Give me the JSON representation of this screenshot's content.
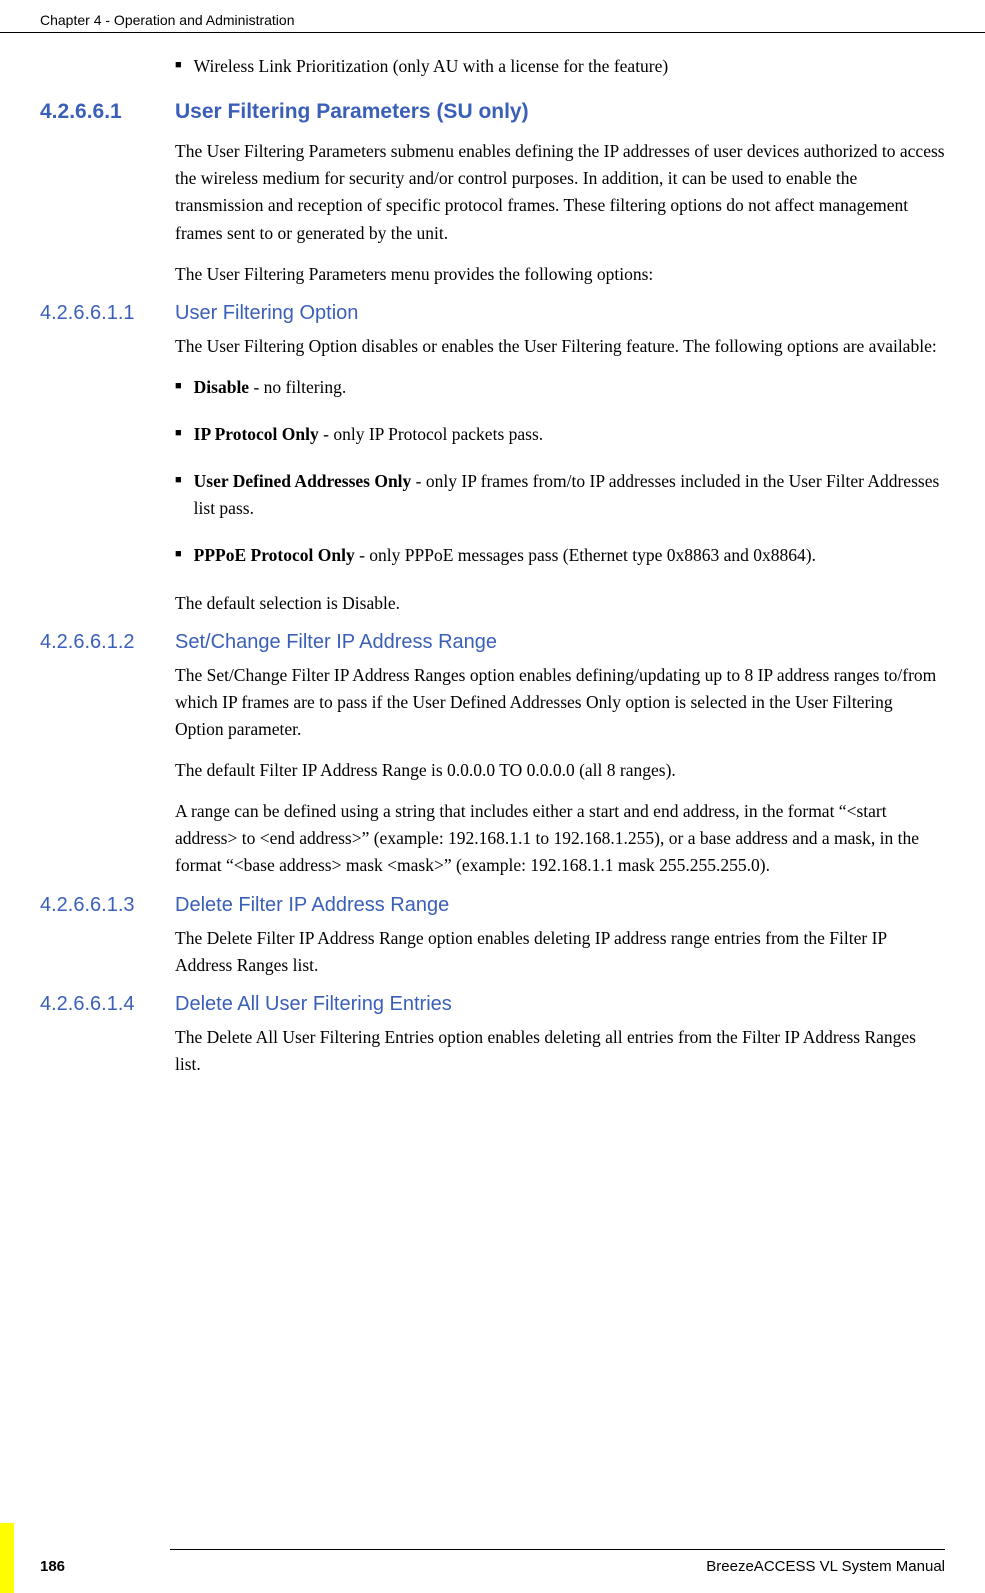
{
  "header": {
    "chapter": "Chapter 4 - Operation and Administration"
  },
  "bullets": {
    "intro": "Wireless Link Prioritization (only AU with a license for the feature)"
  },
  "s1": {
    "num": "4.2.6.6.1",
    "title": "User Filtering Parameters (SU only)",
    "p1": "The User Filtering Parameters submenu enables defining the IP addresses of user devices authorized to access the wireless medium for security and/or control purposes. In addition, it can be used to enable the transmission and reception of specific protocol frames. These filtering options do not affect management frames sent to or generated by the unit.",
    "p2": "The User Filtering Parameters menu provides the following options:"
  },
  "s11": {
    "num": "4.2.6.6.1.1",
    "title": "User Filtering Option",
    "p1": "The User Filtering Option disables or enables the User Filtering feature. The following options are available:",
    "b1_bold": "Disable",
    "b1_rest": " - no filtering.",
    "b2_bold": "IP Protocol Only",
    "b2_rest": " - only IP Protocol packets pass.",
    "b3_bold": "User Defined Addresses Only",
    "b3_rest": " - only IP frames from/to IP addresses included in the User Filter Addresses list pass.",
    "b4_bold": "PPPoE Protocol Only",
    "b4_rest": " - only PPPoE messages pass (Ethernet type 0x8863 and 0x8864).",
    "p2": "The default selection is Disable."
  },
  "s12": {
    "num": "4.2.6.6.1.2",
    "title": "Set/Change Filter IP Address Range",
    "p1": "The Set/Change Filter IP Address Ranges option enables defining/updating up to 8 IP address ranges to/from which IP frames are to pass if the User Defined Addresses Only option is selected in the User Filtering Option parameter.",
    "p2": "The default Filter IP Address Range is 0.0.0.0 TO 0.0.0.0 (all 8 ranges).",
    "p3": "A range can be defined using a string that includes either a start and end address, in the format “<start address> to <end address>” (example: 192.168.1.1 to 192.168.1.255), or a base address and a mask, in the format “<base address> mask <mask>” (example: 192.168.1.1 mask 255.255.255.0)."
  },
  "s13": {
    "num": "4.2.6.6.1.3",
    "title": "Delete Filter IP Address Range",
    "p1": "The Delete Filter IP Address Range option enables deleting IP address range entries from the Filter IP Address Ranges list."
  },
  "s14": {
    "num": "4.2.6.6.1.4",
    "title": "Delete All User Filtering Entries",
    "p1": "The Delete All User Filtering Entries option enables deleting all entries from the Filter IP Address Ranges list."
  },
  "footer": {
    "page": "186",
    "manual": "BreezeACCESS VL System Manual"
  }
}
